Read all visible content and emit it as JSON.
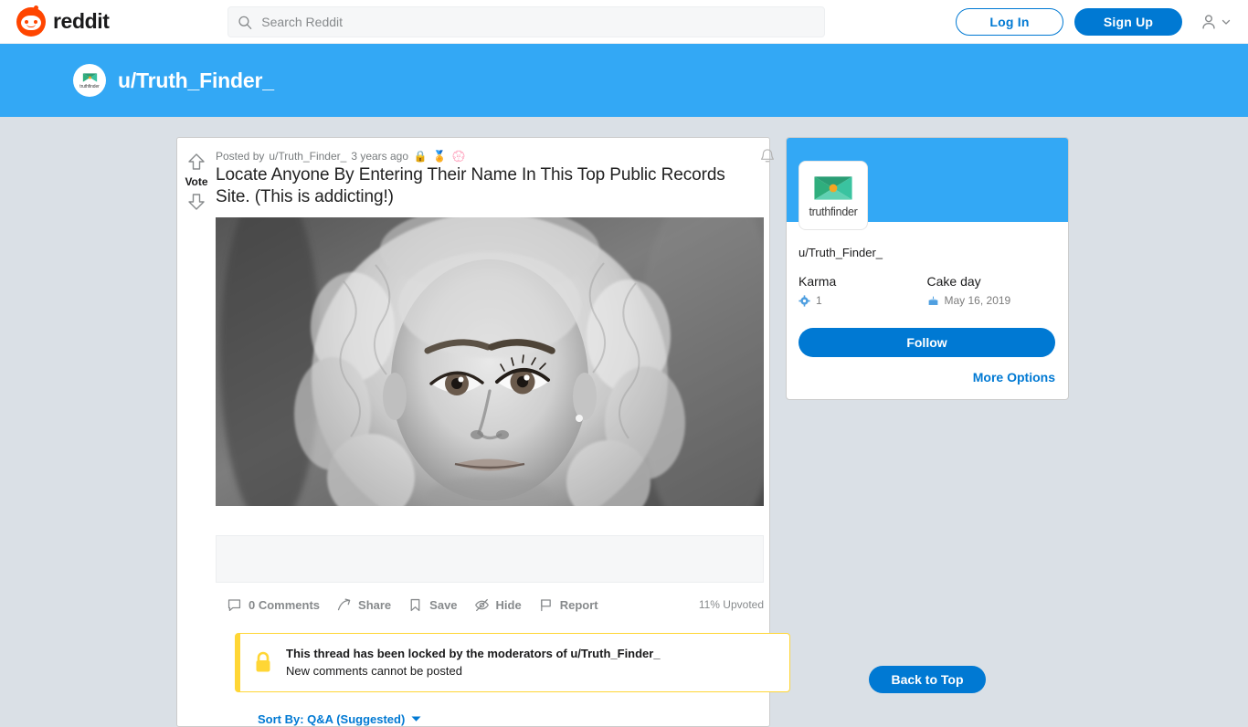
{
  "header": {
    "brand_name": "reddit",
    "brand_icon": "reddit-snoo-icon",
    "search": {
      "placeholder": "Search Reddit",
      "value": "",
      "icon": "search-icon"
    },
    "login_label": "Log In",
    "signup_label": "Sign Up",
    "user_icon": "user-avatar-icon",
    "chevron_icon": "chevron-down-icon"
  },
  "banner": {
    "title": "u/Truth_Finder_",
    "avatar_word": "truthfinder",
    "avatar_icon": "truthfinder-logo-icon",
    "color": "#33a8f5"
  },
  "post": {
    "vote_label": "Vote",
    "upvote_icon": "upvote-arrow-icon",
    "downvote_icon": "downvote-arrow-icon",
    "meta_prefix": "Posted by",
    "author": "u/Truth_Finder_",
    "age": "3 years ago",
    "awards": [
      {
        "name": "lock-icon",
        "glyph": "🔒"
      },
      {
        "name": "gold-award-icon",
        "glyph": "🏅"
      },
      {
        "name": "blue-award-icon",
        "glyph": "💮"
      }
    ],
    "bell_icon": "notification-bell-icon",
    "title": "Locate Anyone By Entering Their Name In This Top Public Records Site. (This is addicting!)",
    "image_alt": "black and white portrait of woman with curly blonde hair",
    "actions": [
      {
        "label": "0 Comments",
        "icon": "comment-bubble-icon"
      },
      {
        "label": "Share",
        "icon": "share-arrow-icon"
      },
      {
        "label": "Save",
        "icon": "bookmark-icon"
      },
      {
        "label": "Hide",
        "icon": "eye-slash-icon"
      },
      {
        "label": "Report",
        "icon": "flag-icon"
      }
    ],
    "upvoted_pct": "11% Upvoted",
    "locked": {
      "icon": "lock-closed-icon",
      "title": "This thread has been locked by the moderators of u/Truth_Finder_",
      "subtitle": "New comments cannot be posted",
      "accent": "#ffd635"
    },
    "sort": {
      "label": "Sort By: Q&A (Suggested)",
      "icon": "caret-down-icon"
    }
  },
  "sidebar": {
    "logo_word": "truthfinder",
    "logo_icon": "truthfinder-logo-icon",
    "username": "u/Truth_Finder_",
    "karma_label": "Karma",
    "karma_value": "1",
    "karma_icon": "karma-badge-icon",
    "cakeday_label": "Cake day",
    "cakeday_value": "May 16, 2019",
    "cakeday_icon": "cake-slice-icon",
    "follow_label": "Follow",
    "more_options_label": "More Options",
    "banner_color": "#33a8f5"
  },
  "footer": {
    "back_to_top_label": "Back to Top"
  }
}
